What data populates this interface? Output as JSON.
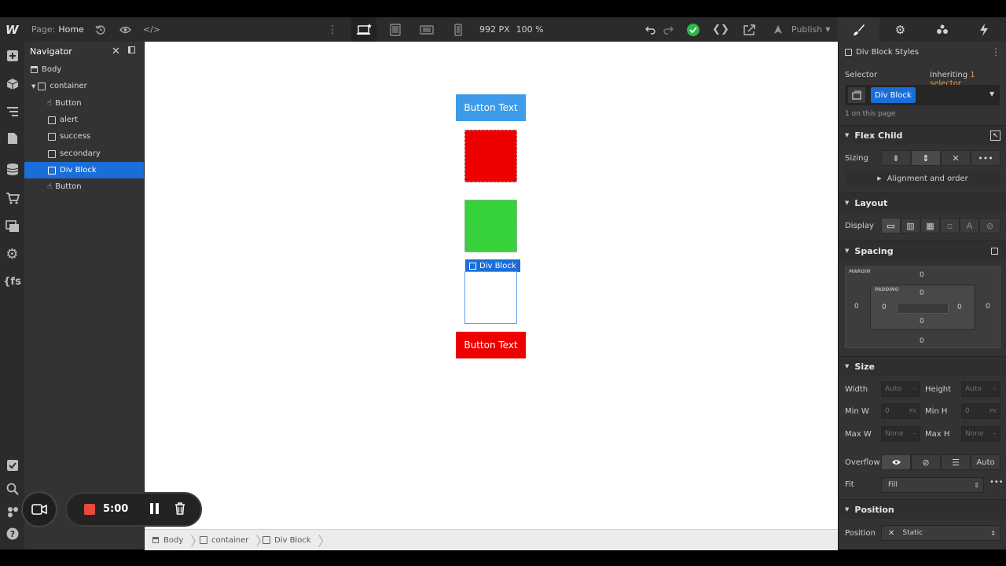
{
  "topbar": {
    "logo": "W",
    "page_label": "Page:",
    "page_name": "Home",
    "width_px": "992 PX",
    "zoom": "100 %",
    "publish": "Publish"
  },
  "navigator": {
    "title": "Navigator",
    "items": [
      {
        "label": "Body"
      },
      {
        "label": "container"
      },
      {
        "label": "Button"
      },
      {
        "label": "alert"
      },
      {
        "label": "success"
      },
      {
        "label": "secondary"
      },
      {
        "label": "Div Block"
      },
      {
        "label": "Button"
      }
    ]
  },
  "canvas": {
    "button_top": "Button Text",
    "selected_tag": "Div Block",
    "button_bottom": "Button Text",
    "colors": {
      "blue": "#3d9be9",
      "red": "#ee0000",
      "green": "#37d13c"
    }
  },
  "breadcrumb": [
    "Body",
    "container",
    "Div Block"
  ],
  "style_panel": {
    "header": "Div Block Styles",
    "selector_label": "Selector",
    "inheriting_prefix": "Inheriting",
    "inheriting_link": "1 selector",
    "selector_tag": "Div Block",
    "on_page": "1 on this page",
    "flex_child": {
      "title": "Flex Child",
      "sizing": "Sizing",
      "alignment": "Alignment and order"
    },
    "layout": {
      "title": "Layout",
      "display": "Display"
    },
    "spacing": {
      "title": "Spacing",
      "margin_label": "MARGIN",
      "padding_label": "PADDING",
      "margin": {
        "top": "0",
        "right": "0",
        "bottom": "0",
        "left": "0"
      },
      "padding": {
        "top": "0",
        "right": "0",
        "bottom": "0",
        "left": "0"
      }
    },
    "size": {
      "title": "Size",
      "width": "Width",
      "height": "Height",
      "min_w": "Min W",
      "min_h": "Min H",
      "max_w": "Max W",
      "max_h": "Max H",
      "auto": "Auto",
      "zero": "0",
      "px": "PX",
      "none": "None",
      "dash": "-",
      "overflow": "Overflow",
      "overflow_auto": "Auto",
      "fit": "Fit",
      "fit_value": "Fill"
    },
    "position": {
      "title": "Position",
      "label": "Position",
      "value": "Static"
    }
  },
  "recorder": {
    "time": "5:00"
  }
}
